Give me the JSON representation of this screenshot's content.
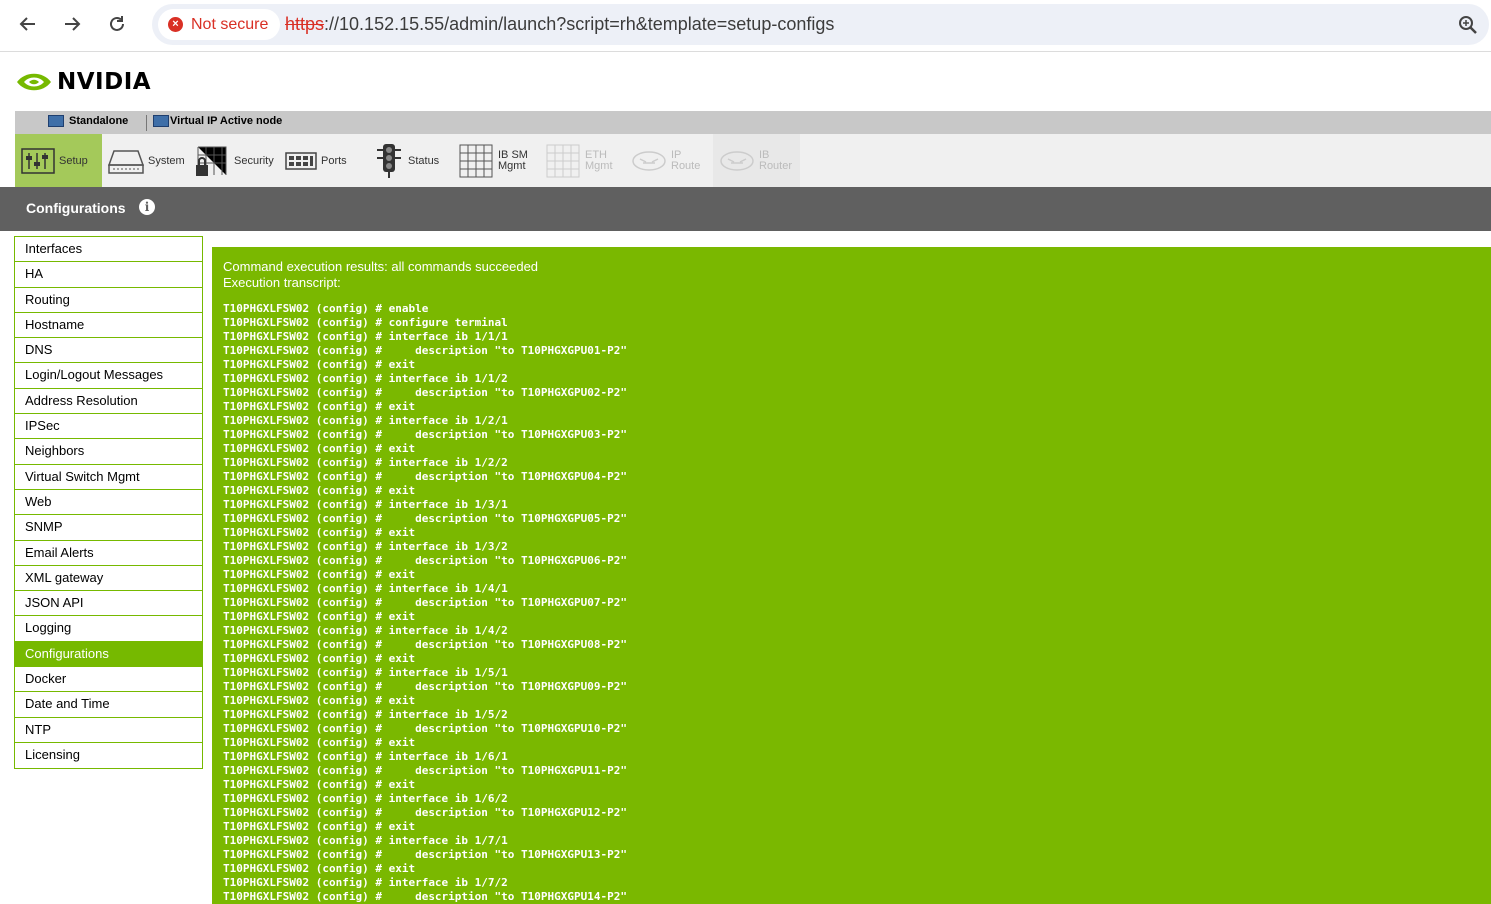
{
  "browser": {
    "security_label": "Not secure",
    "url_scheme": "https",
    "url_rest": "://10.152.15.55/admin/launch?script=rh&template=setup-configs"
  },
  "logo": {
    "text": "NVIDIA"
  },
  "mode_bar": {
    "standalone": "Standalone",
    "vip": "Virtual IP Active node"
  },
  "toolbar": {
    "setup": "Setup",
    "system": "System",
    "security": "Security",
    "ports": "Ports",
    "status": "Status",
    "ibsm_1": "IB SM",
    "ibsm_2": "Mgmt",
    "eth_1": "ETH",
    "eth_2": "Mgmt",
    "ip_1": "IP",
    "ip_2": "Route",
    "ib_1": "IB",
    "ib_2": "Router"
  },
  "header": {
    "title": "Configurations",
    "info_glyph": "i"
  },
  "sidebar": {
    "items": [
      "Interfaces",
      "HA",
      "Routing",
      "Hostname",
      "DNS",
      "Login/Logout Messages",
      "Address Resolution",
      "IPSec",
      "Neighbors",
      "Virtual Switch Mgmt",
      "Web",
      "SNMP",
      "Email Alerts",
      "XML gateway",
      "JSON API",
      "Logging",
      "Configurations",
      "Docker",
      "Date and Time",
      "NTP",
      "Licensing"
    ],
    "active": "Configurations"
  },
  "result": {
    "status_line": "Command execution results: all commands succeeded",
    "transcript_label": "Execution transcript:",
    "prompt": "T10PHGXLFSW02 (config) # ",
    "lines": [
      "enable",
      "configure terminal",
      "interface ib 1/1/1",
      "    description \"to T10PHGXGPU01-P2\"",
      "exit",
      "interface ib 1/1/2",
      "    description \"to T10PHGXGPU02-P2\"",
      "exit",
      "interface ib 1/2/1",
      "    description \"to T10PHGXGPU03-P2\"",
      "exit",
      "interface ib 1/2/2",
      "    description \"to T10PHGXGPU04-P2\"",
      "exit",
      "interface ib 1/3/1",
      "    description \"to T10PHGXGPU05-P2\"",
      "exit",
      "interface ib 1/3/2",
      "    description \"to T10PHGXGPU06-P2\"",
      "exit",
      "interface ib 1/4/1",
      "    description \"to T10PHGXGPU07-P2\"",
      "exit",
      "interface ib 1/4/2",
      "    description \"to T10PHGXGPU08-P2\"",
      "exit",
      "interface ib 1/5/1",
      "    description \"to T10PHGXGPU09-P2\"",
      "exit",
      "interface ib 1/5/2",
      "    description \"to T10PHGXGPU10-P2\"",
      "exit",
      "interface ib 1/6/1",
      "    description \"to T10PHGXGPU11-P2\"",
      "exit",
      "interface ib 1/6/2",
      "    description \"to T10PHGXGPU12-P2\"",
      "exit",
      "interface ib 1/7/1",
      "    description \"to T10PHGXGPU13-P2\"",
      "exit",
      "interface ib 1/7/2",
      "    description \"to T10PHGXGPU14-P2\""
    ]
  },
  "colors": {
    "nvidia_green": "#76b900",
    "panel_green": "#7ab800",
    "header_gray": "#606060",
    "warning_red": "#d93025"
  },
  "icons": [
    "back-arrow-icon",
    "forward-arrow-icon",
    "reload-icon",
    "warning-icon",
    "zoom-icon",
    "info-icon"
  ]
}
